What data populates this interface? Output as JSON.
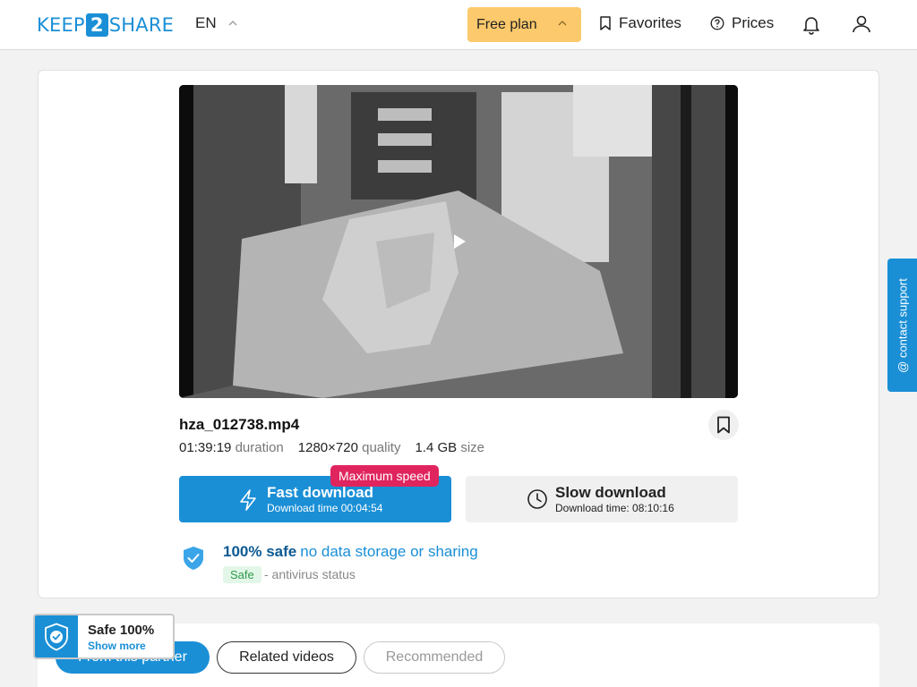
{
  "header": {
    "logo": {
      "pre": "KEEP",
      "mid": "2",
      "post": "SHARE"
    },
    "language": "EN",
    "plan_label": "Free plan",
    "favorites_label": "Favorites",
    "prices_label": "Prices"
  },
  "file": {
    "name": "hza_012738.mp4",
    "duration_value": "01:39:19",
    "duration_label": "duration",
    "quality_value": "1280×720",
    "quality_label": "quality",
    "size_value": "1.4 GB",
    "size_label": "size"
  },
  "downloads": {
    "fast": {
      "title": "Fast download",
      "subtitle": "Download time 00:04:54",
      "badge": "Maximum speed"
    },
    "slow": {
      "title": "Slow download",
      "subtitle": "Download time: 08:10:16"
    }
  },
  "safety": {
    "headline": "100% safe",
    "detail": "no data storage or sharing",
    "tag": "Safe",
    "status_text": "- antivirus status"
  },
  "tabs": [
    {
      "label": "From this partner",
      "active": true
    },
    {
      "label": "Related videos",
      "active": false
    },
    {
      "label": "Recommended",
      "active": false
    }
  ],
  "safe_widget": {
    "title": "Safe 100%",
    "link": "Show more"
  },
  "support_label": "@ contact support",
  "colors": {
    "accent": "#1a8fd6",
    "plan": "#fcc96c",
    "badge": "#e0245e",
    "safe_tag_bg": "#e3f7e8"
  },
  "icons": [
    "chevron-up-icon",
    "bookmark-icon",
    "help-circle-icon",
    "bell-icon",
    "user-icon",
    "play-icon",
    "lightning-icon",
    "clock-icon",
    "shield-check-icon"
  ]
}
